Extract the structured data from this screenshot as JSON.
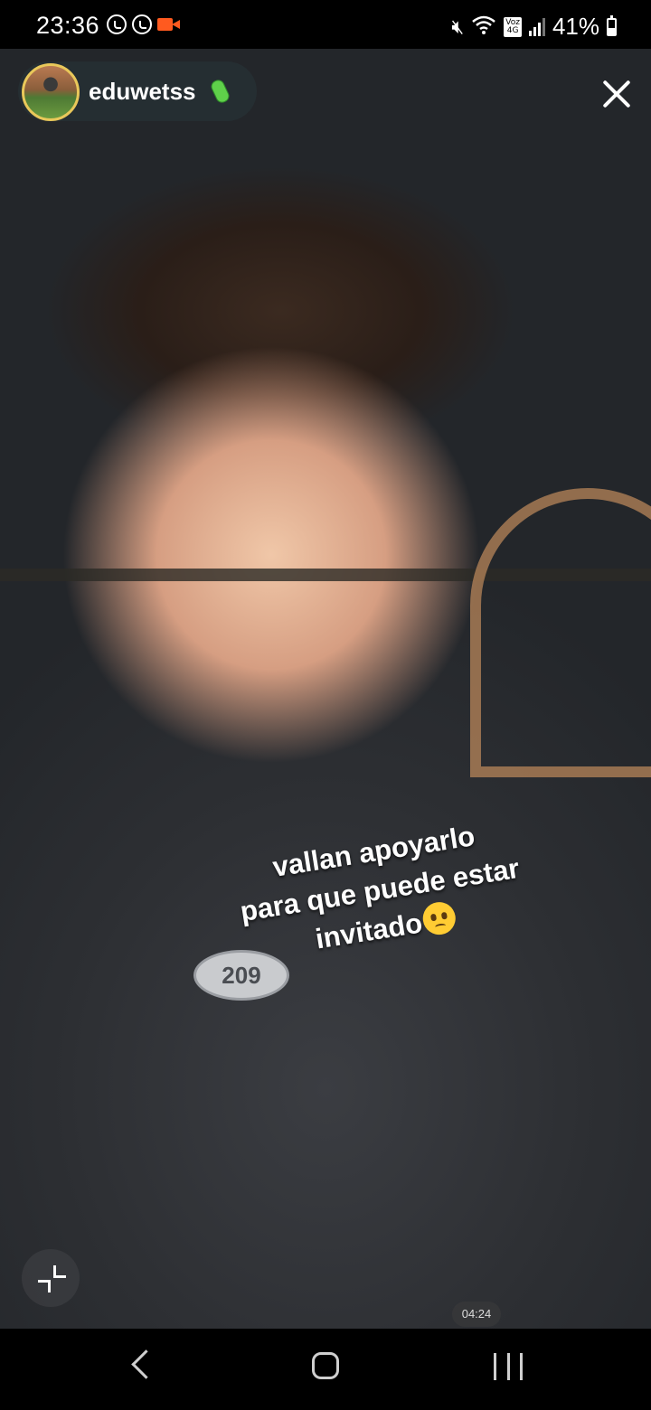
{
  "status_bar": {
    "time": "23:36",
    "battery_percent": "41%",
    "battery_level": 0.41,
    "network_tag_top": "Voz",
    "network_tag_bottom": "4G",
    "icons": [
      "whatsapp-icon",
      "whatsapp-icon",
      "screen-record-icon",
      "mute-icon",
      "wifi-icon",
      "signal-icon",
      "battery-icon"
    ]
  },
  "header": {
    "username": "eduwetss",
    "badge_icon": "cucumber-emoji",
    "close_icon": "close-icon"
  },
  "overlay": {
    "caption_line1": "vallan apoyarlo",
    "caption_line2": "para que puede estar",
    "caption_line3": "invitado",
    "caption_emoji": "pleading-face-emoji",
    "sweater_logo_text": "209"
  },
  "player": {
    "timestamp": "04:24",
    "minimize_icon": "minimize-icon"
  },
  "navigation": {
    "icons": [
      "back-icon",
      "home-icon",
      "recent-apps-icon"
    ]
  },
  "colors": {
    "record_indicator": "#ff5a1f",
    "avatar_ring": "#e9c85a",
    "badge_green": "#5fd14a"
  }
}
